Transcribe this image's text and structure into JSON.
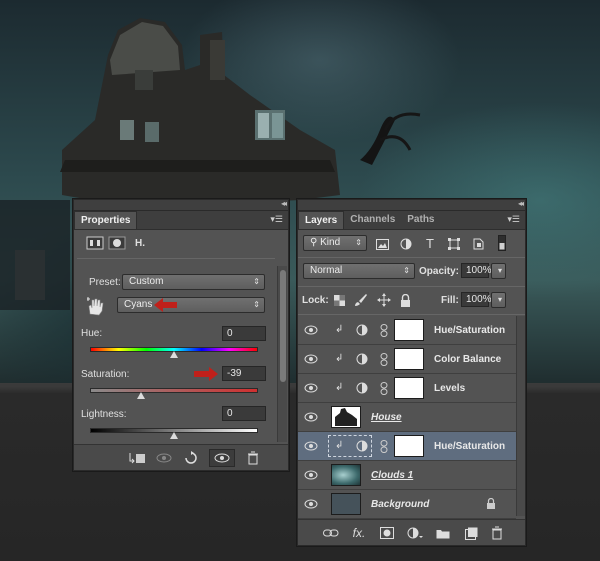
{
  "properties": {
    "tab": "Properties",
    "header_label": "H.",
    "preset_label": "Preset:",
    "preset_value": "Custom",
    "channel_value": "Cyans",
    "hue_label": "Hue:",
    "hue_value": "0",
    "saturation_label": "Saturation:",
    "saturation_value": "-39",
    "lightness_label": "Lightness:",
    "lightness_value": "0",
    "hue_slider_level": 0.5,
    "saturation_slider_level": 0.305,
    "lightness_slider_level": 0.5,
    "annotation_color": "#c0201a"
  },
  "layers_panel": {
    "tabs": [
      "Layers",
      "Channels",
      "Paths"
    ],
    "filter_kind": "Kind",
    "blend_mode": "Normal",
    "opacity_label": "Opacity:",
    "opacity_value": "100%",
    "lock_label": "Lock:",
    "fill_label": "Fill:",
    "fill_value": "100%",
    "selection_color": "#5f6d7f",
    "layers": [
      {
        "name": "Hue/Saturation",
        "type": "adjustment",
        "clipped": true
      },
      {
        "name": "Color Balance",
        "type": "adjustment",
        "clipped": true
      },
      {
        "name": "Levels",
        "type": "adjustment",
        "clipped": true
      },
      {
        "name": "House",
        "type": "image",
        "clipped": false
      },
      {
        "name": "Hue/Saturation",
        "type": "adjustment",
        "clipped": true,
        "selected": true
      },
      {
        "name": "Clouds 1",
        "type": "image",
        "clipped": false
      },
      {
        "name": "Background",
        "type": "background",
        "clipped": false,
        "locked": true
      }
    ]
  }
}
